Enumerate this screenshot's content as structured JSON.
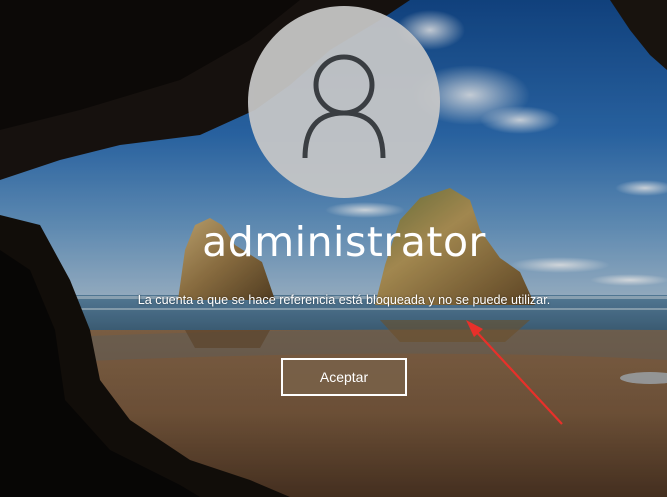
{
  "user": {
    "name": "administrator",
    "avatar_icon": "user-avatar-icon"
  },
  "message": {
    "text": "La cuenta a que se hace referencia está bloqueada y no se puede utilizar."
  },
  "button": {
    "label": "Aceptar"
  },
  "colors": {
    "button_bg": "#786048",
    "button_border": "#ffffff",
    "text": "#ffffff",
    "arrow": "#e8302a"
  }
}
